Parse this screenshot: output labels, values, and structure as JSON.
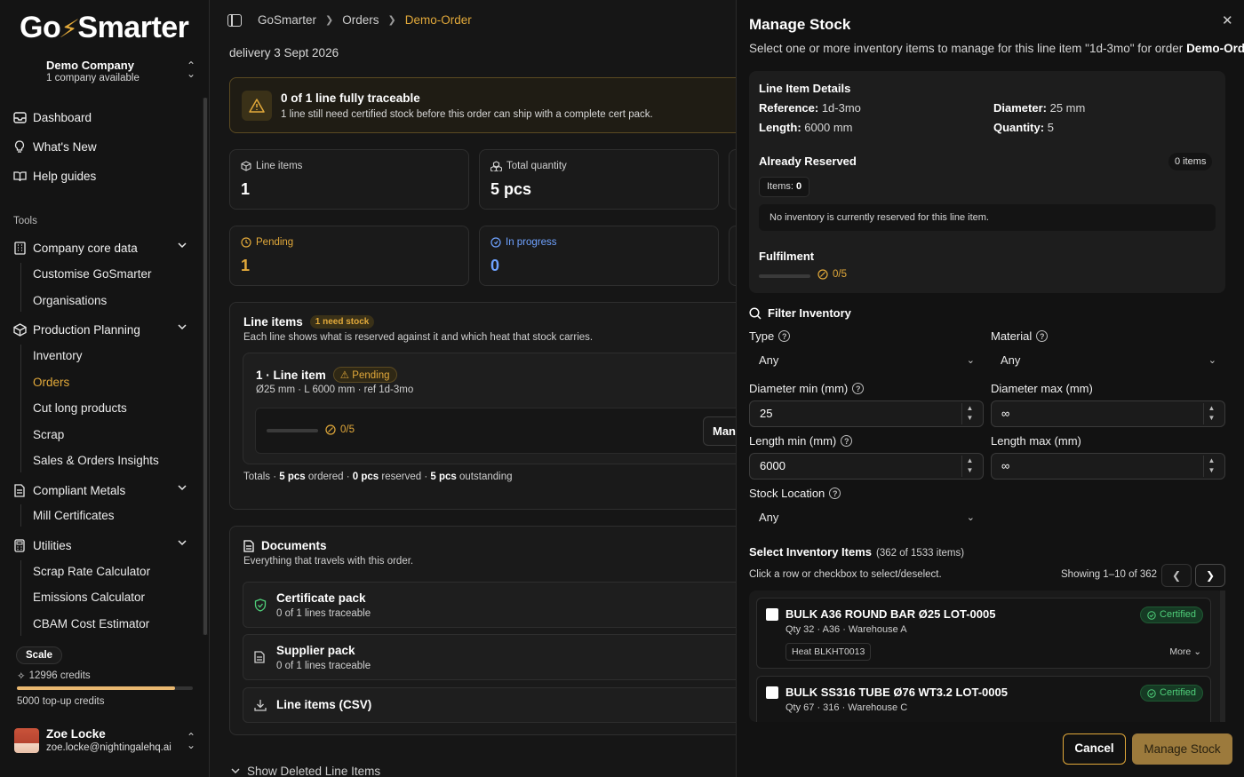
{
  "app": {
    "logo_left": "Go",
    "logo_bolt": "⚡",
    "logo_right": "Smarter"
  },
  "company": {
    "name": "Demo Company",
    "sub": "1 company available"
  },
  "nav": {
    "dashboard": "Dashboard",
    "whats_new": "What's New",
    "help": "Help guides",
    "tools_label": "Tools",
    "company_core": "Company core data",
    "customise": "Customise GoSmarter",
    "organisations": "Organisations",
    "production": "Production Planning",
    "inventory": "Inventory",
    "orders": "Orders",
    "cut_long": "Cut long products",
    "scrap": "Scrap",
    "sales_insights": "Sales & Orders Insights",
    "compliant": "Compliant Metals",
    "mill_certs": "Mill Certificates",
    "utilities": "Utilities",
    "scrap_rate": "Scrap Rate Calculator",
    "emissions": "Emissions Calculator",
    "cbam": "CBAM Cost Estimator"
  },
  "plan": {
    "badge": "Scale",
    "credits": "12996 credits",
    "credit_fraction": 0.9,
    "topup": "5000 top-up credits"
  },
  "user": {
    "name": "Zoe Locke",
    "email": "zoe.locke@nightingalehq.ai"
  },
  "breadcrumb": {
    "root": "GoSmarter",
    "section": "Orders",
    "current": "Demo-Order"
  },
  "order": {
    "delivery": "delivery 3 Sept 2026",
    "warning_title": "0 of 1 line fully traceable",
    "warning_sub": "1 line still need certified stock before this order can ship with a complete cert pack.",
    "stats": {
      "line_items_label": "Line items",
      "line_items_value": "1",
      "total_qty_label": "Total quantity",
      "total_qty_value": "5 pcs",
      "pending_label": "Pending",
      "pending_value": "1",
      "progress_label": "In progress",
      "progress_value": "0"
    },
    "line_items": {
      "title": "Line items",
      "need_badge": "1 need stock",
      "sub": "Each line shows what is reserved against it and which heat that stock carries.",
      "item_title": "1 · Line item",
      "item_status": "Pending",
      "item_meta": "Ø25 mm · L 6000 mm · ref 1d-3mo",
      "item_fulfilment": "0/5",
      "manage_btn": "Manage Stock",
      "totals": {
        "ordered": "5 pcs",
        "ordered_lbl": "ordered",
        "reserved": "0 pcs",
        "reserved_lbl": "reserved",
        "outstanding": "5 pcs",
        "outstanding_lbl": "outstanding",
        "prefix": "Totals ·"
      }
    },
    "documents": {
      "title": "Documents",
      "sub": "Everything that travels with this order.",
      "cert_pack": "Certificate pack",
      "cert_pack_sub": "0 of 1 lines traceable",
      "supplier_pack": "Supplier pack",
      "supplier_pack_sub": "0 of 1 lines traceable",
      "csv": "Line items (CSV)"
    },
    "show_deleted": "Show Deleted Line Items"
  },
  "panel": {
    "title": "Manage Stock",
    "desc_pre": "Select one or more inventory items to manage for this line item \"1d-3mo\" for order ",
    "desc_order": "Demo-Order",
    "desc_post": ".",
    "details": {
      "heading": "Line Item Details",
      "ref_lbl": "Reference:",
      "ref_val": "1d-3mo",
      "dia_lbl": "Diameter:",
      "dia_val": "25 mm",
      "len_lbl": "Length:",
      "len_val": "6000 mm",
      "qty_lbl": "Quantity:",
      "qty_val": "5",
      "reserved_heading": "Already Reserved",
      "items_pill": "0 items",
      "items_lbl": "Items:",
      "items_val": "0",
      "no_inventory": "No inventory is currently reserved for this line item.",
      "fulfilment_heading": "Fulfilment",
      "fulfilment_val": "0/5"
    },
    "filter": {
      "heading": "Filter Inventory",
      "type_lbl": "Type",
      "type_val": "Any",
      "material_lbl": "Material",
      "material_val": "Any",
      "dia_min_lbl": "Diameter min (mm)",
      "dia_min_val": "25",
      "dia_max_lbl": "Diameter max (mm)",
      "dia_max_val": "∞",
      "len_min_lbl": "Length min (mm)",
      "len_min_val": "6000",
      "len_max_lbl": "Length max (mm)",
      "len_max_val": "∞",
      "location_lbl": "Stock Location",
      "location_val": "Any"
    },
    "select": {
      "heading": "Select Inventory Items",
      "count": "(362 of 1533 items)",
      "sub": "Click a row or checkbox to select/deselect.",
      "showing": "Showing 1–10 of 362",
      "rows": [
        {
          "title": "BULK A36 ROUND BAR Ø25 LOT-0005",
          "meta": "Qty 32 · A36 · Warehouse A",
          "heat": "Heat BLKHT0013",
          "status": "Certified",
          "more": "More"
        },
        {
          "title": "BULK SS316 TUBE Ø76 WT3.2 LOT-0005",
          "meta": "Qty 67 · 316 · Warehouse C",
          "heat": "",
          "status": "Certified",
          "more": ""
        }
      ]
    },
    "cancel": "Cancel",
    "manage": "Manage Stock"
  }
}
